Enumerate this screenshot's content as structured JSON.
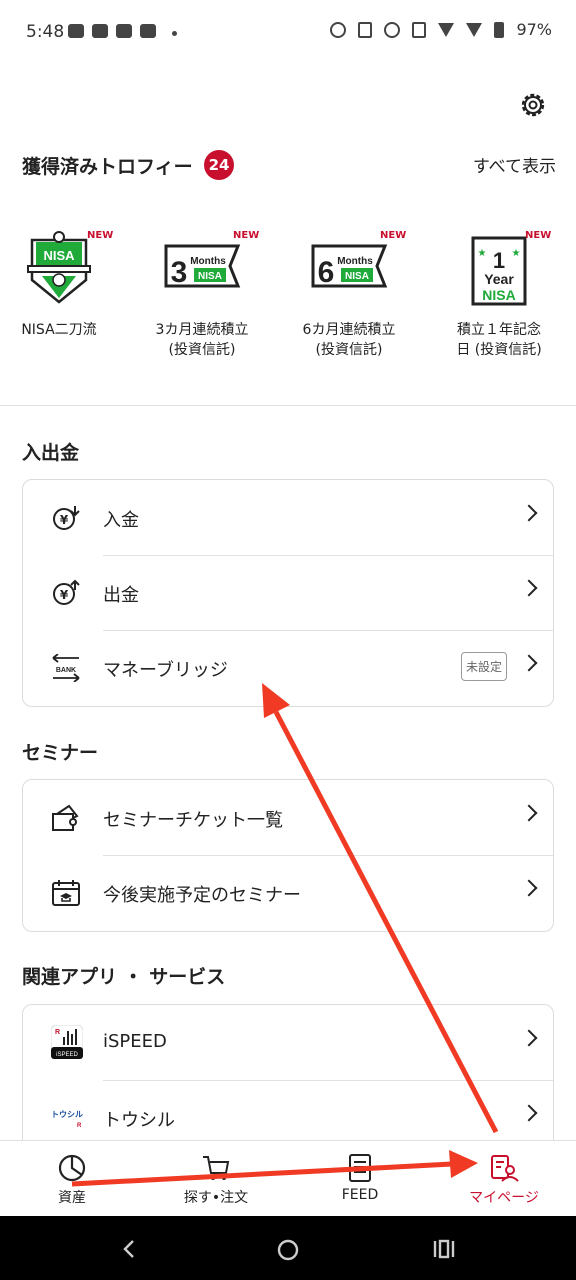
{
  "status_bar": {
    "time": "5:48",
    "battery": "97%"
  },
  "trophies": {
    "title": "獲得済みトロフィー",
    "count": "24",
    "show_all": "すべて表示",
    "items": [
      {
        "label": "NISA二刀流",
        "badge_text": "NISA",
        "new": "NEW"
      },
      {
        "label": "3カ月連続積立\n(投資信託)",
        "badge_text": "3 Months NISA",
        "new": "NEW"
      },
      {
        "label": "6カ月連続積立\n(投資信託)",
        "badge_text": "6 Months NISA",
        "new": "NEW"
      },
      {
        "label": "積立１年記念\n日 (投資信託)",
        "badge_text": "1 Year NISA",
        "new": "NEW"
      }
    ]
  },
  "deposit_section": {
    "title": "入出金",
    "items": [
      {
        "label": "入金"
      },
      {
        "label": "出金"
      },
      {
        "label": "マネーブリッジ",
        "tag": "未設定"
      }
    ]
  },
  "seminar_section": {
    "title": "セミナー",
    "items": [
      {
        "label": "セミナーチケット一覧"
      },
      {
        "label": "今後実施予定のセミナー"
      }
    ]
  },
  "apps_section": {
    "title": "関連アプリ ・ サービス",
    "items": [
      {
        "label": "iSPEED"
      },
      {
        "label": "トウシル"
      }
    ]
  },
  "bottom_nav": {
    "items": [
      {
        "label": "資産"
      },
      {
        "label": "探す•注文"
      },
      {
        "label": "FEED"
      },
      {
        "label": "マイページ",
        "active": true
      }
    ]
  },
  "colors": {
    "accent": "#c8102e",
    "nisa_green": "#1faa3a",
    "annotation_arrow": "#f03a24"
  }
}
